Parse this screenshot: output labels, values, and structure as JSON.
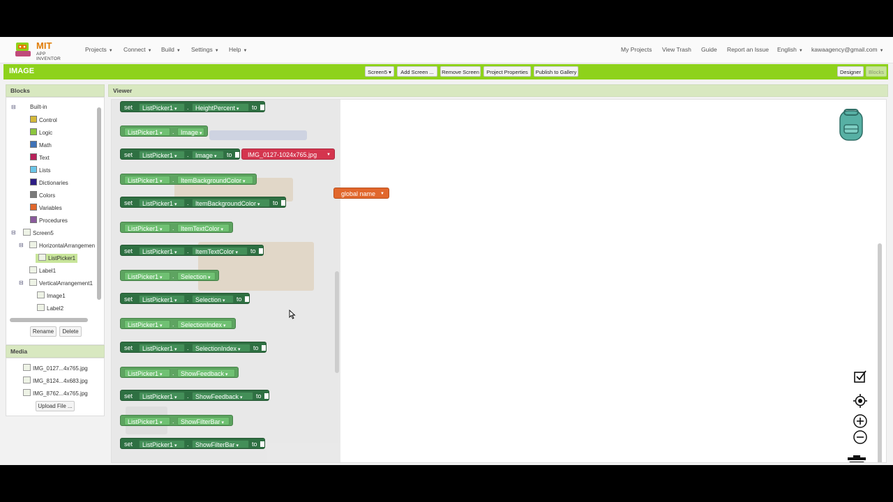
{
  "brand": {
    "name": "MIT",
    "sub": "APP INVENTOR"
  },
  "nav": {
    "menus": [
      "Projects",
      "Connect",
      "Build",
      "Settings",
      "Help"
    ],
    "right": [
      "My Projects",
      "View Trash",
      "Guide",
      "Report an Issue",
      "English",
      "kawaagency@gmail.com"
    ]
  },
  "toolbar": {
    "project": "IMAGE",
    "screen": "Screen5",
    "add_screen": "Add Screen ...",
    "remove_screen": "Remove Screen",
    "project_properties": "Project Properties",
    "publish": "Publish to Gallery",
    "designer": "Designer",
    "blocks": "Blocks"
  },
  "blocks_panel": {
    "title": "Blocks",
    "builtin": "Built-in",
    "categories": [
      {
        "label": "Control",
        "color": "#d4b93a"
      },
      {
        "label": "Logic",
        "color": "#8cc63f"
      },
      {
        "label": "Math",
        "color": "#3f72b7"
      },
      {
        "label": "Text",
        "color": "#b8215a"
      },
      {
        "label": "Lists",
        "color": "#6bc6e8"
      },
      {
        "label": "Dictionaries",
        "color": "#2d1d85"
      },
      {
        "label": "Colors",
        "color": "#7a7a7a"
      },
      {
        "label": "Variables",
        "color": "#e1672c"
      },
      {
        "label": "Procedures",
        "color": "#8a5a9c"
      }
    ],
    "screen": "Screen5",
    "components": {
      "horizontal": "HorizontalArrangemen",
      "listpicker": "ListPicker1",
      "label1": "Label1",
      "vertical": "VerticalArrangement1",
      "image1": "Image1",
      "label2": "Label2"
    },
    "rename": "Rename",
    "delete": "Delete"
  },
  "media_panel": {
    "title": "Media",
    "files": [
      "IMG_0127...4x765.jpg",
      "IMG_8124...4x683.jpg",
      "IMG_8762...4x765.jpg"
    ],
    "upload": "Upload File ..."
  },
  "viewer": {
    "title": "Viewer",
    "kw_set": "set",
    "kw_to": "to",
    "component": "ListPicker1",
    "rows": [
      {
        "kind": "setter",
        "prop": "HeightPercent"
      },
      {
        "kind": "getter",
        "prop": "Image"
      },
      {
        "kind": "setter",
        "prop": "Image",
        "value": "IMG_0127-1024x765.jpg"
      },
      {
        "kind": "getter",
        "prop": "ItemBackgroundColor"
      },
      {
        "kind": "setter",
        "prop": "ItemBackgroundColor"
      },
      {
        "kind": "getter",
        "prop": "ItemTextColor"
      },
      {
        "kind": "setter",
        "prop": "ItemTextColor"
      },
      {
        "kind": "getter",
        "prop": "Selection"
      },
      {
        "kind": "setter",
        "prop": "Selection"
      },
      {
        "kind": "getter",
        "prop": "SelectionIndex"
      },
      {
        "kind": "setter",
        "prop": "SelectionIndex"
      },
      {
        "kind": "getter",
        "prop": "ShowFeedback"
      },
      {
        "kind": "setter",
        "prop": "ShowFeedback"
      },
      {
        "kind": "getter",
        "prop": "ShowFilterBar"
      },
      {
        "kind": "setter",
        "prop": "ShowFilterBar"
      }
    ],
    "global_block": "global name",
    "colors": {
      "getter": "#58a15b",
      "setter": "#266b3b",
      "text": "#d32d47",
      "variable": "#e1672c"
    }
  }
}
